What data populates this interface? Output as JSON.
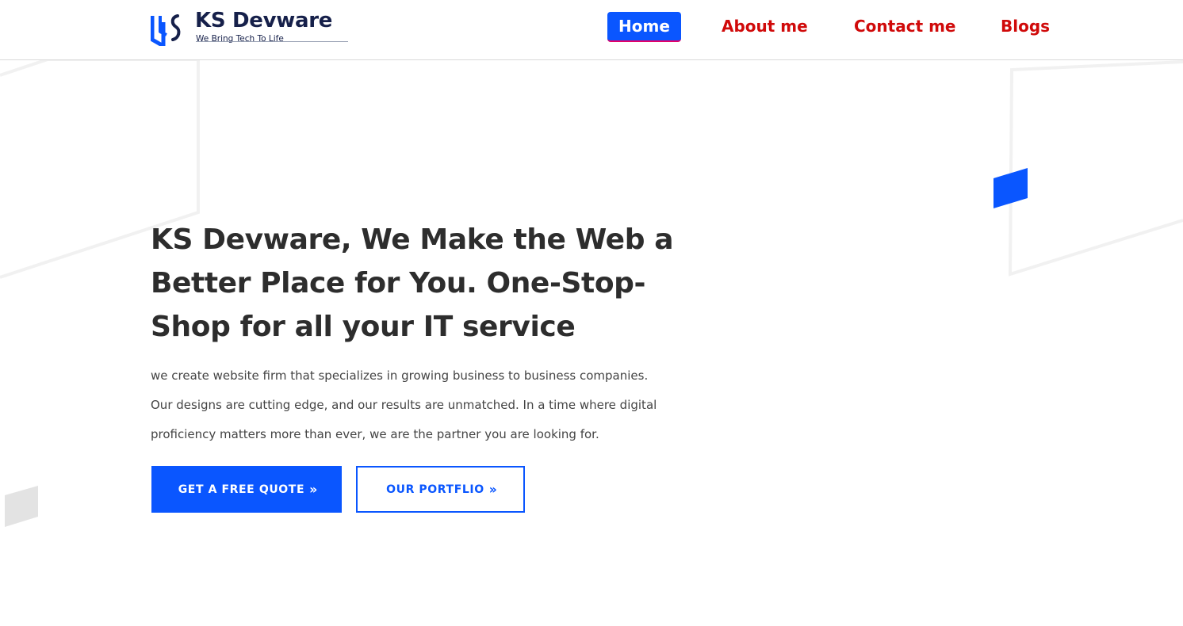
{
  "brand": {
    "name": "KS Devware",
    "tagline": "We Bring Tech To Life"
  },
  "nav": {
    "home": "Home",
    "about": "About me",
    "contact": "Contact me",
    "blogs": "Blogs"
  },
  "hero": {
    "title": "KS Devware, We Make the Web a Better Place for You. One-Stop-Shop for all your IT service",
    "description": "we create website firm that specializes in growing business to business companies. Our designs are cutting edge, and our results are unmatched. In a time where digital proficiency matters more than ever, we are the partner you are looking for.",
    "quote_button": "GET A FREE QUOTE",
    "portfolio_button": "OUR PORTFLIO",
    "button_icon": "double-chevron-right-icon"
  },
  "colors": {
    "accent_blue": "#0a56ff",
    "nav_red": "#d00a0a",
    "heading_dark": "#2d2d2d",
    "brand_navy": "#16204a"
  }
}
